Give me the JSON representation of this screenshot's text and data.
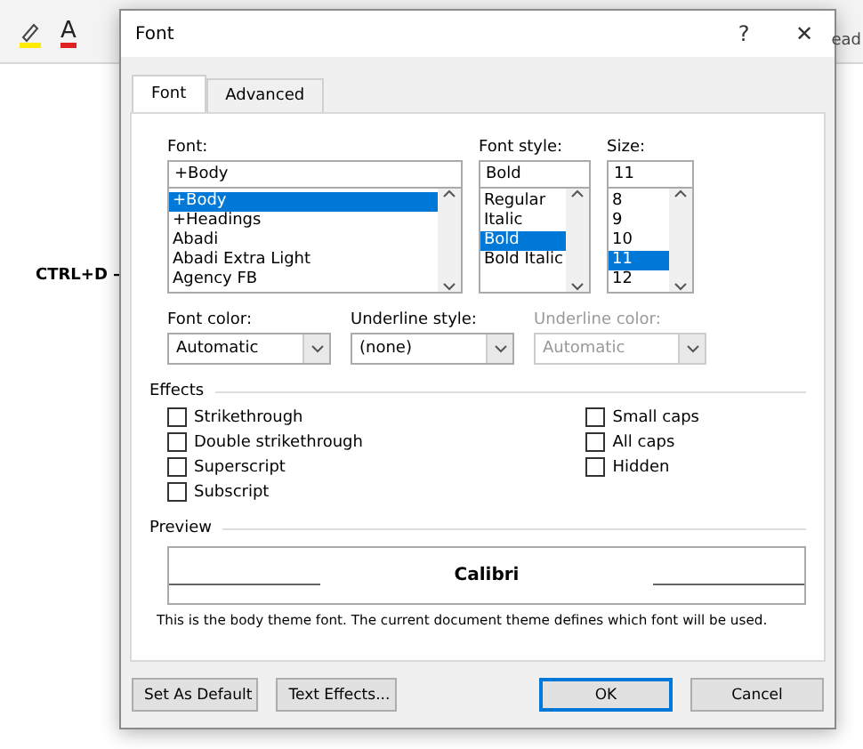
{
  "background": {
    "ribbon_text": "ead",
    "shortcut": "CTRL+D –",
    "font_color_letter": "A"
  },
  "window": {
    "title": "Font",
    "help": "?",
    "close": "✕"
  },
  "tabs": [
    {
      "label": "Font",
      "selected": true
    },
    {
      "label": "Advanced",
      "selected": false
    }
  ],
  "font": {
    "label": "Font:",
    "value": "+Body",
    "items": [
      {
        "label": "+Body",
        "selected": true
      },
      {
        "label": "+Headings",
        "selected": false
      },
      {
        "label": "Abadi",
        "selected": false
      },
      {
        "label": "Abadi Extra Light",
        "selected": false
      },
      {
        "label": "Agency FB",
        "selected": false
      }
    ]
  },
  "font_style": {
    "label": "Font style:",
    "value": "Bold",
    "items": [
      {
        "label": "Regular",
        "selected": false
      },
      {
        "label": "Italic",
        "selected": false
      },
      {
        "label": "Bold",
        "selected": true
      },
      {
        "label": "Bold Italic",
        "selected": false
      }
    ]
  },
  "size": {
    "label": "Size:",
    "value": "11",
    "items": [
      {
        "label": "8",
        "selected": false
      },
      {
        "label": "9",
        "selected": false
      },
      {
        "label": "10",
        "selected": false
      },
      {
        "label": "11",
        "selected": true
      },
      {
        "label": "12",
        "selected": false
      }
    ]
  },
  "dropdowns": [
    {
      "label": "Font color:",
      "value": "Automatic",
      "disabled": false
    },
    {
      "label": "Underline style:",
      "value": "(none)",
      "disabled": false
    },
    {
      "label": "Underline color:",
      "value": "Automatic",
      "disabled": true
    }
  ],
  "effects": {
    "title": "Effects",
    "left": [
      {
        "label": "Strikethrough",
        "checked": false
      },
      {
        "label": "Double strikethrough",
        "checked": false
      },
      {
        "label": "Superscript",
        "checked": false
      },
      {
        "label": "Subscript",
        "checked": false
      }
    ],
    "right": [
      {
        "label": "Small caps",
        "checked": false
      },
      {
        "label": "All caps",
        "checked": false
      },
      {
        "label": "Hidden",
        "checked": false
      }
    ]
  },
  "preview": {
    "title": "Preview",
    "sample": "Calibri",
    "note": "This is the body theme font. The current document theme defines which font will be used."
  },
  "buttons": [
    {
      "label": "Set As Default",
      "default": false
    },
    {
      "label": "Text Effects...",
      "default": false
    },
    {
      "label": "OK",
      "default": true
    },
    {
      "label": "Cancel",
      "default": false
    }
  ]
}
